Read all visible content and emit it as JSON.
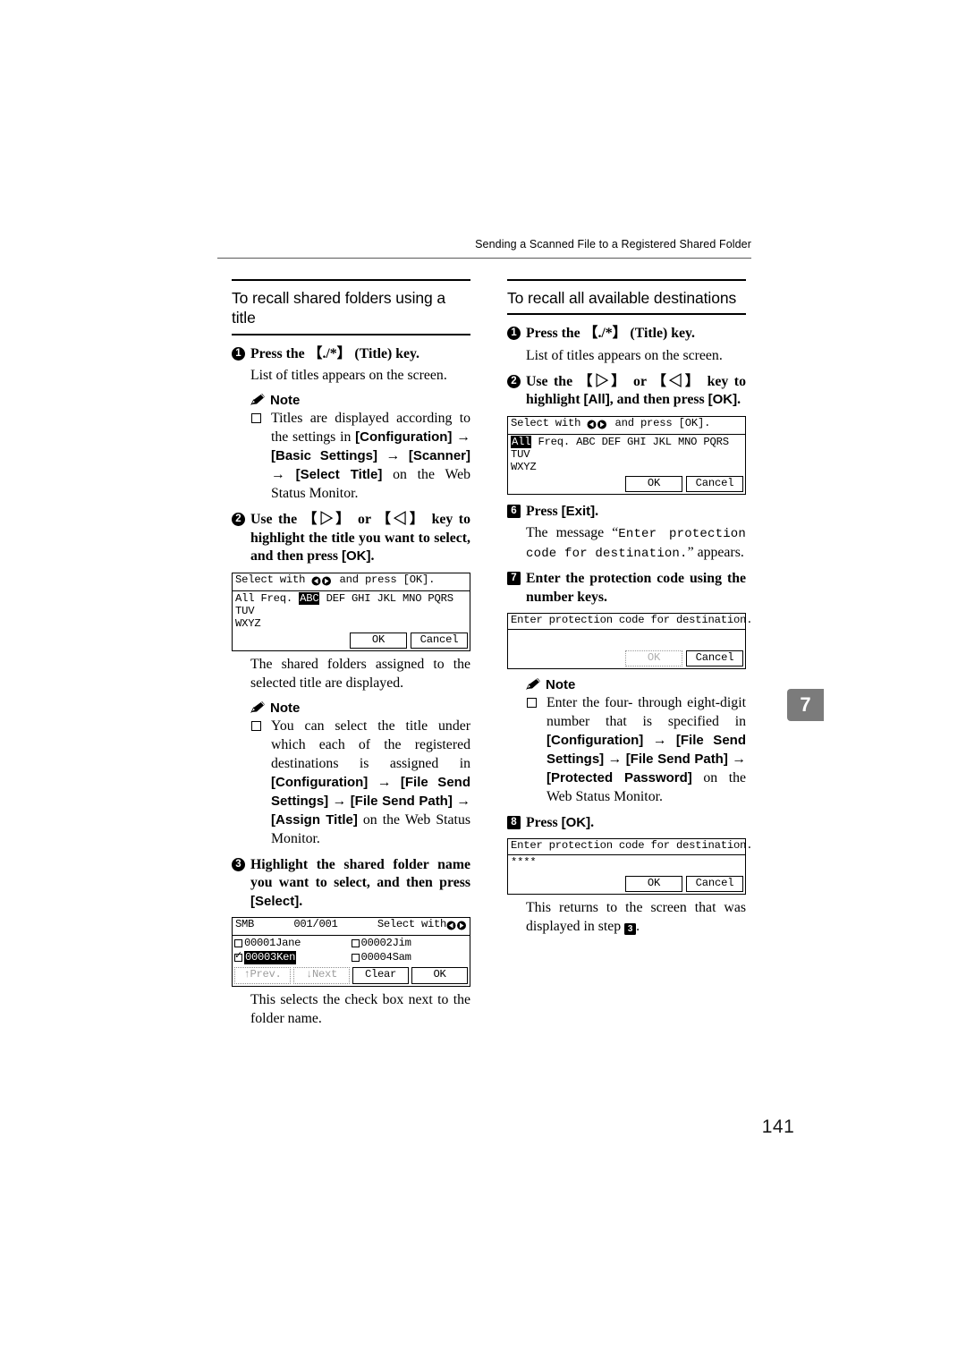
{
  "running_head": "Sending a Scanned File to a Registered Shared Folder",
  "chapter_tab": "7",
  "page_number": "141",
  "left_column": {
    "section_title": "To recall shared folders using a title",
    "step1": {
      "number": "1",
      "text_a": "Press the ",
      "keycap": "【./*】",
      "text_b": " (Title) key."
    },
    "step1_body": "List of titles appears on the screen.",
    "note1_label": "Note",
    "note1_item": {
      "t1": "Titles are displayed according to the settings in ",
      "b1": "[Configuration]",
      "a1": " → ",
      "b2": "[Basic Settings]",
      "a2": " → ",
      "b3": "[Scanner]",
      "a3": " → ",
      "b4": "[Select Title]",
      "t2": " on the Web Status Monitor."
    },
    "step2": {
      "number": "2",
      "t1": "Use the ",
      "k1": "【▷】",
      "t2": " or ",
      "k2": "【◁】",
      "t3": " key to highlight the title you want to select, and then press ",
      "b1": "[OK]",
      "t4": "."
    },
    "lcd_title": {
      "title_a": "Select with ",
      "title_b": " and press [OK]."
    },
    "lcd_filters": {
      "pre": "All Freq. ",
      "highlighted": "ABC",
      "post": " DEF GHI JKL MNO PQRS TUV",
      "line2": "WXYZ"
    },
    "lcd_buttons": {
      "ok": "OK",
      "cancel": "Cancel"
    },
    "body2": "The shared folders assigned to the selected title are displayed.",
    "note2_label": "Note",
    "note2_item": {
      "t1": "You can select the title under which each of the registered destinations is assigned in ",
      "b1": "[Configuration]",
      "a1": " → ",
      "b2": "[File Send Settings]",
      "a2": " → ",
      "b3": "[File Send Path]",
      "a3": " → ",
      "b4": "[Assign Title]",
      "t2": " on the Web Status Monitor."
    },
    "step3": {
      "number": "3",
      "t1": "Highlight the shared folder name you want to select, and then press ",
      "b1": "[Select]",
      "t2": "."
    },
    "smb_lcd": {
      "header_left": "SMB",
      "header_center": "001/001",
      "header_right": "Select with",
      "rows": [
        {
          "left": {
            "checked": false,
            "label": "00001Jane"
          },
          "right": {
            "checked": false,
            "label": "00002Jim"
          }
        },
        {
          "left": {
            "checked": true,
            "label": "00003Ken",
            "highlight": true
          },
          "right": {
            "checked": false,
            "label": "00004Sam"
          }
        }
      ],
      "buttons": [
        {
          "label": "↑Prev.",
          "dim": true
        },
        {
          "label": "↓Next",
          "dim": true
        },
        {
          "label": "Clear",
          "dim": false
        },
        {
          "label": "OK",
          "dim": false
        }
      ]
    },
    "body3": "This selects the check box next to the folder name."
  },
  "right_column": {
    "section_title": "To recall all available destinations",
    "step1": {
      "number": "1",
      "text_a": "Press the ",
      "keycap": "【./*】",
      "text_b": " (Title) key."
    },
    "step1_body": "List of titles appears on the screen.",
    "step2": {
      "number": "2",
      "t1": "Use the ",
      "k1": "【▷】",
      "t2": " or ",
      "k2": "【◁】",
      "t3": " key to highlight ",
      "b1": "[All]",
      "t4": ", and then press ",
      "b2": "[OK]",
      "t5": "."
    },
    "lcd_title": {
      "title_a": "Select with ",
      "title_b": " and press [OK]."
    },
    "lcd_filters": {
      "highlighted": "All",
      "post": " Freq. ABC DEF GHI JKL MNO PQRS TUV",
      "line2": "WXYZ"
    },
    "lcd_buttons": {
      "ok": "OK",
      "cancel": "Cancel"
    },
    "step6": {
      "number": "6",
      "t1": "Press ",
      "b1": "[Exit]",
      "t2": "."
    },
    "step6_body": {
      "t1": "The message “",
      "mono": "Enter protection code for destination.",
      "t2": "” appears."
    },
    "step7": {
      "number": "7",
      "t1": "Enter the protection code using the number keys."
    },
    "lcd7": {
      "title": "Enter protection code for destination.",
      "value": "",
      "buttons": {
        "ok": "OK",
        "cancel": "Cancel"
      },
      "ok_dim": true
    },
    "note_label": "Note",
    "note_item": {
      "t1": "Enter the four- through eight-digit number that is specified in ",
      "b1": "[Configuration]",
      "a1": " → ",
      "b2": "[File Send Settings]",
      "a2": " → ",
      "b3": "[File Send Path]",
      "a3": " → ",
      "b4": "[Protected Password]",
      "t2": " on the Web Status Monitor."
    },
    "step8": {
      "number": "8",
      "t1": "Press ",
      "b1": "[OK]",
      "t2": "."
    },
    "lcd8": {
      "title": "Enter protection code for destination.",
      "value": "****",
      "buttons": {
        "ok": "OK",
        "cancel": "Cancel"
      },
      "ok_dim": false
    },
    "body_final": {
      "t1": "This returns to the screen that was displayed in step ",
      "step_ref": "3",
      "t2": "."
    }
  }
}
